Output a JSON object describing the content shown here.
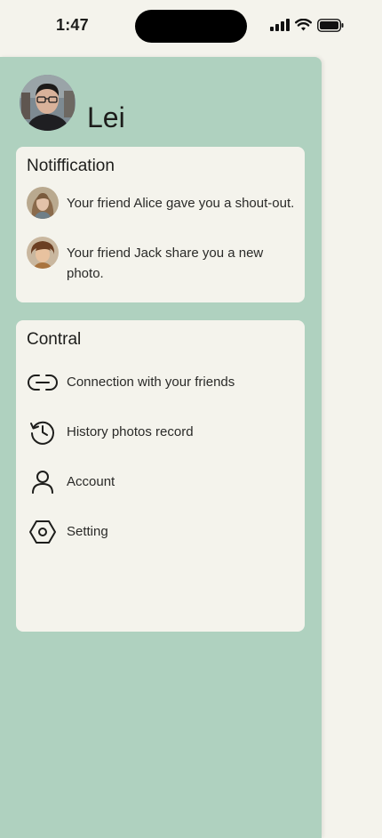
{
  "status_bar": {
    "time": "1:47"
  },
  "profile": {
    "name": "Lei"
  },
  "notifications": {
    "title": "Notiffication",
    "items": [
      {
        "text": "Your friend Alice gave you a shout-out."
      },
      {
        "text": "Your friend Jack share you a new photo."
      }
    ]
  },
  "control": {
    "title": "Contral",
    "items": [
      {
        "label": "Connection with your friends",
        "icon": "link-icon"
      },
      {
        "label": "History photos record",
        "icon": "history-icon"
      },
      {
        "label": "Account",
        "icon": "account-icon"
      },
      {
        "label": "Setting",
        "icon": "settings-icon"
      }
    ]
  },
  "colors": {
    "background": "#f4f3ec",
    "drawer": "#afd1bf",
    "card": "#f4f3ec",
    "text": "#1d1d1b"
  }
}
